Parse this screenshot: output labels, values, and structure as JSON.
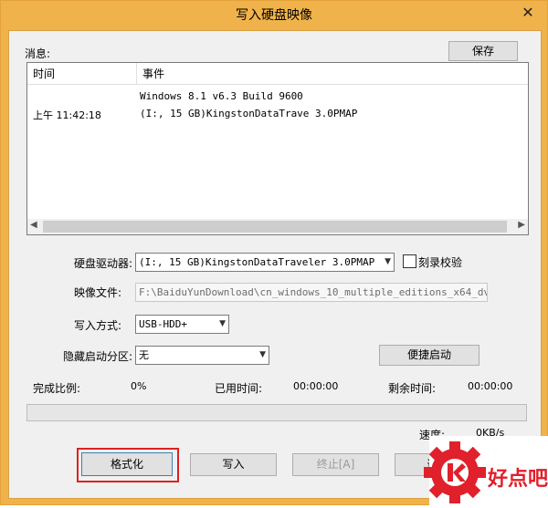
{
  "window": {
    "title": "写入硬盘映像",
    "close_glyph": "✕"
  },
  "messages": {
    "label": "消息:",
    "save_button": "保存",
    "columns": [
      "时间",
      "事件"
    ],
    "rows": [
      {
        "time": "",
        "event": "Windows 8.1 v6.3 Build 9600"
      },
      {
        "time": "上午 11:42:18",
        "event": "(I:, 15 GB)KingstonDataTrave  3.0PMAP"
      }
    ]
  },
  "drive": {
    "label": "硬盘驱动器:",
    "value": "(I:, 15 GB)KingstonDataTraveler 3.0PMAP"
  },
  "verify": {
    "label": "刻录校验",
    "checked": false
  },
  "image_file": {
    "label": "映像文件:",
    "value": "F:\\BaiduYunDownload\\cn_windows_10_multiple_editions_x64_dvd"
  },
  "write_mode": {
    "label": "写入方式:",
    "value": "USB-HDD+"
  },
  "hidden_partition": {
    "label": "隐藏启动分区:",
    "value": "无"
  },
  "quick_boot_button": "便捷启动",
  "stats": {
    "ratio_label": "完成比例:",
    "ratio_value": "0%",
    "elapsed_label": "已用时间:",
    "elapsed_value": "00:00:00",
    "remaining_label": "剩余时间:",
    "remaining_value": "00:00:00",
    "speed_label": "速度:",
    "speed_value": "0KB/s"
  },
  "progress": 0.0,
  "buttons": {
    "format": "格式化",
    "write": "写入",
    "abort": "终止[A]",
    "back": "返回"
  },
  "logo": {
    "text": "好点吧",
    "color": "#e0202a"
  }
}
